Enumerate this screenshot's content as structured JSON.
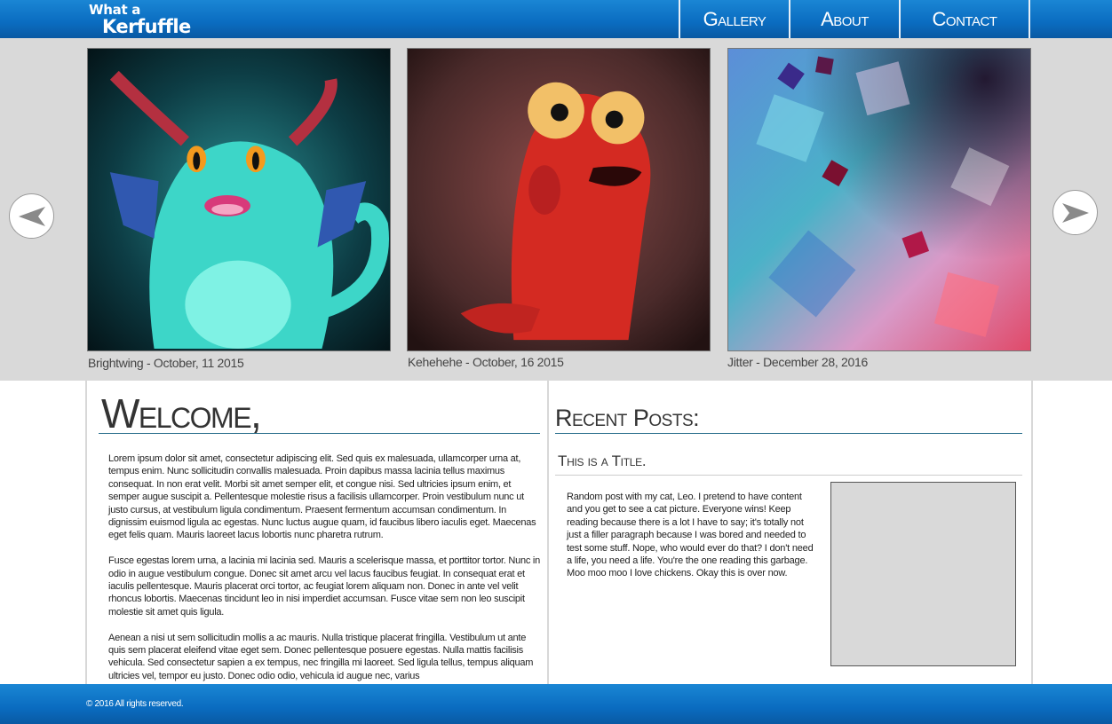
{
  "header": {
    "logo_line1": "What a",
    "logo_line2": "Kerfuffle",
    "nav": [
      {
        "label": "Gallery"
      },
      {
        "label": "About"
      },
      {
        "label": "Contact"
      }
    ]
  },
  "carousel": {
    "items": [
      {
        "caption": "Brightwing - October, 11 2015"
      },
      {
        "caption": "Kehehehe - October, 16 2015"
      },
      {
        "caption": "Jitter -  December 28, 2016"
      }
    ]
  },
  "welcome": {
    "title": "Welcome,",
    "paragraphs": [
      "Lorem ipsum dolor sit amet, consectetur adipiscing elit. Sed quis ex malesuada, ullamcorper urna at, tempus enim. Nunc sollicitudin convallis malesuada. Proin dapibus massa lacinia tellus maximus consequat. In non erat velit. Morbi sit amet semper elit, et congue nisi. Sed ultricies ipsum enim, et semper augue suscipit a. Pellentesque molestie risus a facilisis ullamcorper. Proin vestibulum nunc ut justo cursus, at vestibulum ligula condimentum. Praesent fermentum accumsan condimentum. In dignissim euismod ligula ac egestas. Nunc luctus augue quam, id faucibus libero iaculis eget. Maecenas eget felis quam. Mauris laoreet lacus lobortis nunc pharetra rutrum.",
      "Fusce egestas lorem urna, a lacinia mi lacinia sed. Mauris a scelerisque massa, et porttitor tortor. Nunc in odio in augue vestibulum congue. Donec sit amet arcu vel lacus faucibus feugiat. In consequat erat et iaculis pellentesque. Mauris placerat orci tortor, ac feugiat lorem aliquam non. Donec in ante vel velit rhoncus lobortis. Maecenas tincidunt leo in nisi imperdiet accumsan. Fusce vitae sem non leo suscipit molestie sit amet quis ligula.",
      "Aenean a nisi ut sem sollicitudin mollis a ac mauris. Nulla tristique placerat fringilla. Vestibulum ut ante quis sem placerat eleifend vitae eget sem. Donec pellentesque posuere egestas. Nulla mattis facilisis vehicula. Sed consectetur sapien a ex tempus, nec fringilla mi laoreet. Sed ligula tellus, tempus aliquam ultricies vel, tempor eu justo. Donec odio odio, vehicula id augue nec, varius"
    ]
  },
  "recent": {
    "title": "Recent Posts:",
    "post_title": "This is a Title.",
    "post_body": "Random post with  my cat, Leo. I pretend to have content and you get to see a cat picture. Everyone wins! Keep reading because there is a lot I have to say; it's totally not just a filler paragraph because I was bored and needed to test some stuff. Nope, who would ever do that? I don't need a life, you need a life. You're the one reading this garbage. Moo moo moo I love chickens. Okay this is over now."
  },
  "footer": {
    "copyright": "© 2016 All rights reserved."
  },
  "icons": {
    "prev": "arrow-left-icon",
    "next": "arrow-right-icon"
  },
  "colors": {
    "header_blue": "#0a6cc0",
    "carousel_bg": "#d9d9d9",
    "rule": "#2a6f8c"
  }
}
